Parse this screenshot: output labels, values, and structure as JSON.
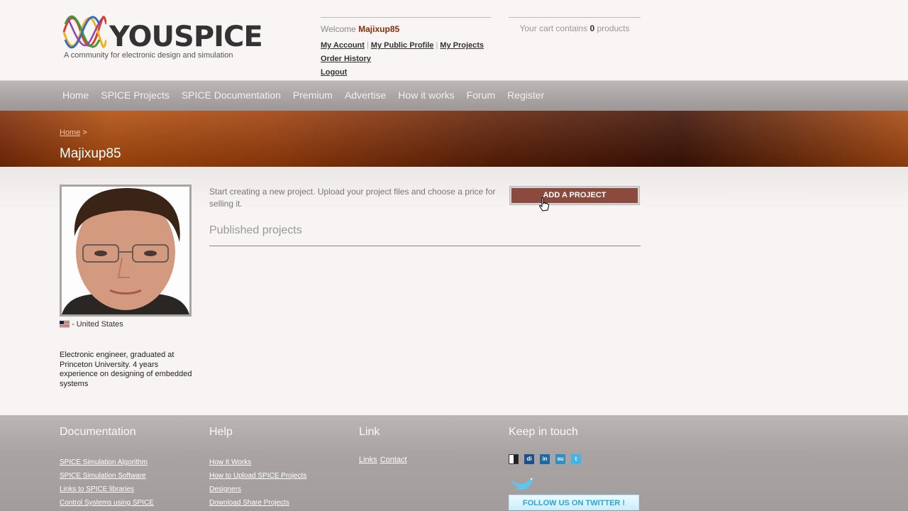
{
  "logo": {
    "wordmark": "YOUSPICE",
    "tagline": "A community for electronic design and simulation"
  },
  "account": {
    "welcome_prefix": "Welcome",
    "username": "Majixup85",
    "my_account": "My Account",
    "my_public_profile": "My Public Profile",
    "my_projects": "My Projects",
    "order_history": "Order History",
    "logout": "Logout",
    "separator": "|"
  },
  "cart": {
    "prefix": "Your cart contains",
    "count": "0",
    "suffix": "products"
  },
  "nav": [
    "Home",
    "SPICE Projects",
    "SPICE Documentation",
    "Premium",
    "Advertise",
    "How it works",
    "Forum",
    "Register"
  ],
  "breadcrumb": {
    "home": "Home",
    "sep": ">"
  },
  "page_title": "Majixup85",
  "profile": {
    "country": "- United States",
    "bio": "Electronic engineer, graduated at Princeton University. 4 years experience on designing of embedded systems"
  },
  "main": {
    "intro": "Start creating a new project. Upload your project files and choose a price for selling it.",
    "add_button": "ADD A PROJECT",
    "published_title": "Published projects"
  },
  "footer": {
    "documentation": {
      "title": "Documentation",
      "links": [
        "SPICE Simulation Algorithm",
        "SPICE Simulation Software",
        "Links to SPICE libraries",
        "Control Systems using SPICE"
      ]
    },
    "help": {
      "title": "Help",
      "links": [
        "How It Works",
        "How to Upload SPICE Projects",
        "Designers",
        "Download Share Projects"
      ]
    },
    "link": {
      "title": "Link",
      "links": [
        "Links",
        "Contact"
      ]
    },
    "touch": {
      "title": "Keep in touch",
      "social": [
        {
          "name": "delicious-icon",
          "glyph": "",
          "color": "#3274d1"
        },
        {
          "name": "digg-icon",
          "glyph": "di",
          "color": "#1d4f8a"
        },
        {
          "name": "linkedin-icon",
          "glyph": "in",
          "color": "#1a6aa8"
        },
        {
          "name": "stumbleupon-icon",
          "glyph": "su",
          "color": "#2f8fc0"
        },
        {
          "name": "twitter-icon",
          "glyph": "t",
          "color": "#45b4e6"
        }
      ],
      "follow_button": "FOLLOW US ON TWITTER !"
    }
  },
  "colors": {
    "accent": "#8a2d0c",
    "button": "#8a4a3e",
    "nav_bg": "#a8a3a2"
  }
}
